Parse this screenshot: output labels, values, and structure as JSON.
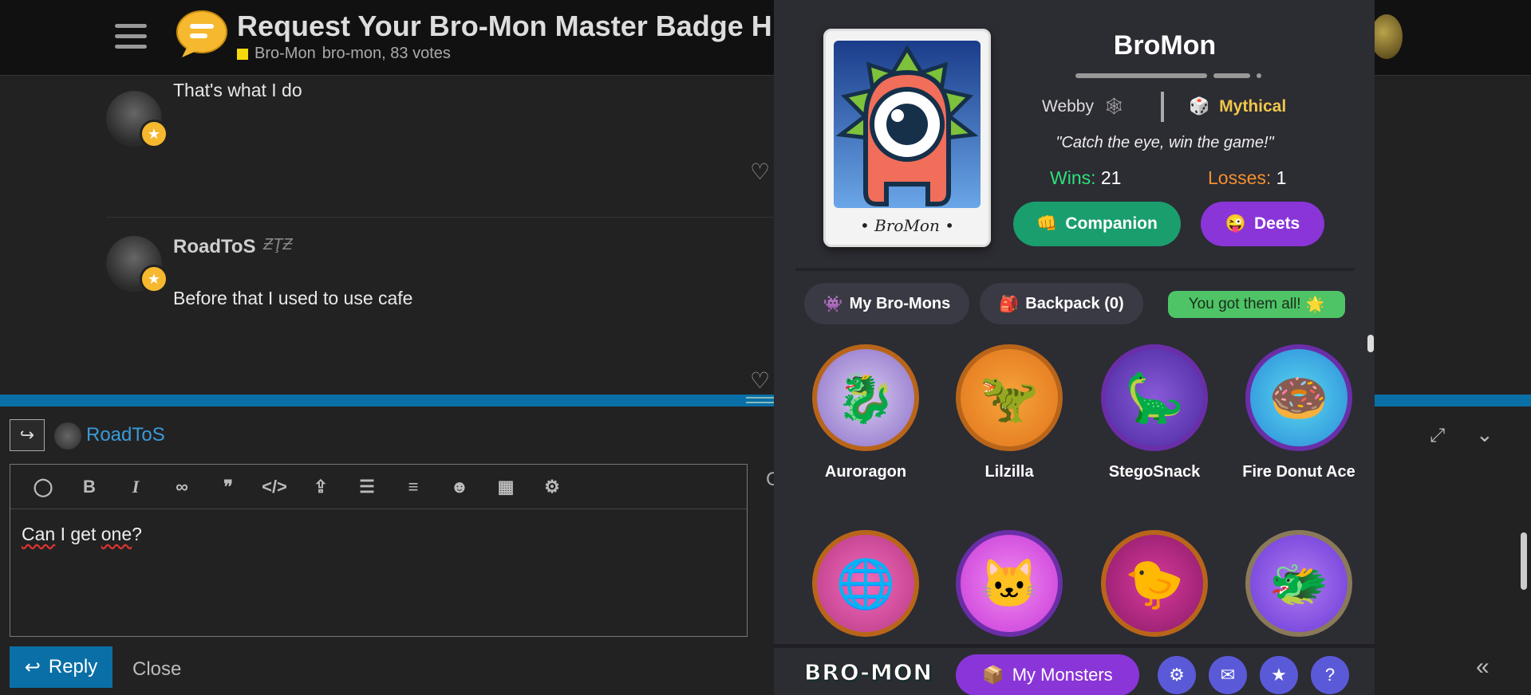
{
  "header": {
    "title": "Request Your Bro-Mon Master Badge H",
    "category": "Bro-Mon",
    "meta": "bro-mon, 83 votes"
  },
  "posts": [
    {
      "text": "That's what I do"
    },
    {
      "username": "RoadToS",
      "flair": "ƵŢƵ",
      "text": "Before that I used to use cafe"
    }
  ],
  "composer": {
    "reply_to": "RoadToS",
    "content_word1": "Can",
    "content_word2": " I get ",
    "content_word3": "one",
    "content_word4": "?",
    "reply_label": "Reply",
    "close_label": "Close",
    "preview_char": "C"
  },
  "panel": {
    "name": "BroMon",
    "card_label": "• BroMon •",
    "type": "Webby",
    "rarity": "Mythical",
    "quote": "\"Catch the eye, win the game!\"",
    "wins_label": "Wins:",
    "wins": "21",
    "losses_label": "Losses:",
    "losses": "1",
    "companion_label": "Companion",
    "deets_label": "Deets",
    "tabs": {
      "my_bromons": "My Bro-Mons",
      "backpack": "Backpack (0)"
    },
    "got_all": "You got them all!",
    "monsters": [
      {
        "name": "Auroragon",
        "emoji": "🐉"
      },
      {
        "name": "Lilzilla",
        "emoji": "🦖"
      },
      {
        "name": "StegoSnack",
        "emoji": "🦕"
      },
      {
        "name": "Fire Donut Ace",
        "emoji": "🍩"
      },
      {
        "name": "",
        "emoji": "🌐"
      },
      {
        "name": "",
        "emoji": "🐱"
      },
      {
        "name": "",
        "emoji": "🐤"
      },
      {
        "name": "",
        "emoji": "🐲"
      }
    ],
    "footer": {
      "logo": "BRO-MON",
      "my_monsters": "My Monsters"
    }
  },
  "colors": {
    "accent_blue": "#0a6fa6",
    "wins_green": "#2ee07a",
    "losses_orange": "#f5902e",
    "rarity_gold": "#f0c64a",
    "companion_green": "#1a9e6e",
    "deets_purple": "#8a35d8"
  }
}
